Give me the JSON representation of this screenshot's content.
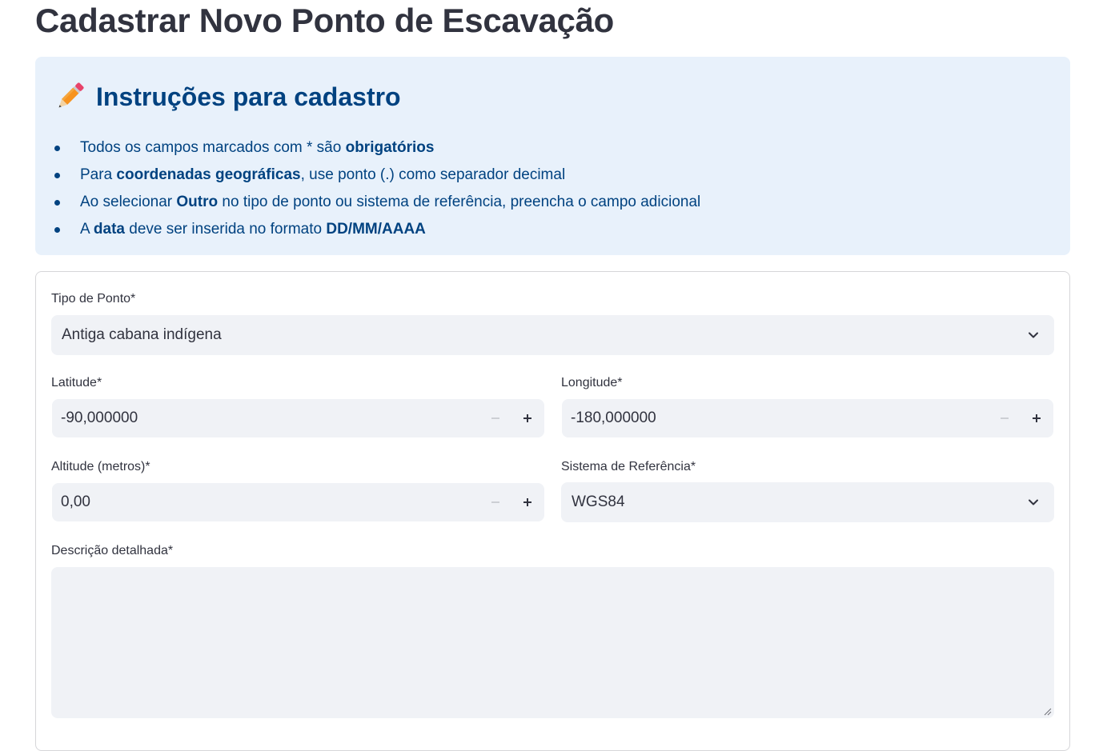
{
  "page": {
    "title": "Cadastrar Novo Ponto de Escavação"
  },
  "instructions": {
    "icon": "pencil-icon",
    "title": "Instruções para cadastro",
    "items": [
      {
        "parts": [
          {
            "t": "Todos os campos marcados com * são ",
            "b": false
          },
          {
            "t": "obrigatórios",
            "b": true
          }
        ]
      },
      {
        "parts": [
          {
            "t": "Para ",
            "b": false
          },
          {
            "t": "coordenadas geográficas",
            "b": true
          },
          {
            "t": ", use ponto (.) como separador decimal",
            "b": false
          }
        ]
      },
      {
        "parts": [
          {
            "t": "Ao selecionar ",
            "b": false
          },
          {
            "t": "Outro",
            "b": true
          },
          {
            "t": " no tipo de ponto ou sistema de referência, preencha o campo adicional",
            "b": false
          }
        ]
      },
      {
        "parts": [
          {
            "t": "A ",
            "b": false
          },
          {
            "t": "data",
            "b": true
          },
          {
            "t": " deve ser inserida no formato ",
            "b": false
          },
          {
            "t": "DD/MM/AAAA",
            "b": true
          }
        ]
      }
    ]
  },
  "form": {
    "tipo_ponto": {
      "label": "Tipo de Ponto*",
      "value": "Antiga cabana indígena"
    },
    "latitude": {
      "label": "Latitude*",
      "value": "-90,000000"
    },
    "longitude": {
      "label": "Longitude*",
      "value": "-180,000000"
    },
    "altitude": {
      "label": "Altitude (metros)*",
      "value": "0,00"
    },
    "sistema_referencia": {
      "label": "Sistema de Referência*",
      "value": "WGS84"
    },
    "descricao": {
      "label": "Descrição detalhada*",
      "value": ""
    }
  },
  "colors": {
    "info_background": "#e8f1fb",
    "info_text": "#004280",
    "input_background": "#f0f2f6",
    "text": "#31333f"
  }
}
